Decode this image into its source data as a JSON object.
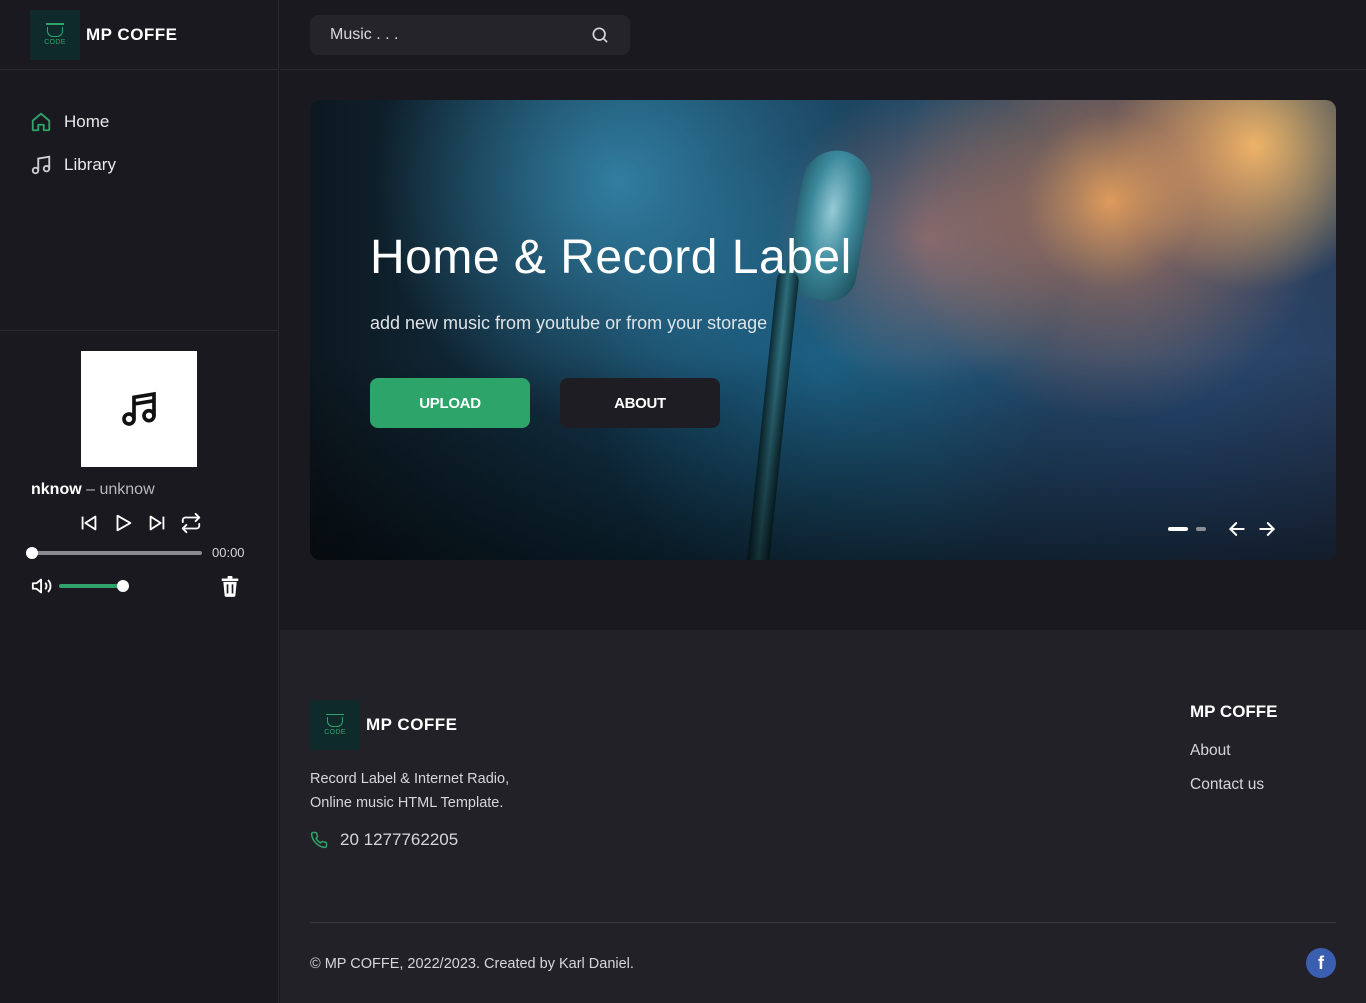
{
  "brand": {
    "name": "MP COFFE",
    "logo_text": "CODE"
  },
  "sidebar": {
    "items": [
      {
        "label": "Home",
        "icon": "home-icon",
        "active": true
      },
      {
        "label": "Library",
        "icon": "music-note-icon",
        "active": false
      }
    ]
  },
  "player": {
    "track_title": "nknow",
    "separator": "–",
    "artist": "unknow",
    "time": "00:00",
    "progress": 0,
    "volume": 1
  },
  "search": {
    "placeholder": "Music . . ."
  },
  "hero": {
    "title": "Home & Record Label",
    "subtitle": "add new music from youtube or from your storage",
    "upload_label": "UPLOAD",
    "about_label": "ABOUT",
    "active_slide": 1,
    "slide_count": 2
  },
  "footer": {
    "brand_name": "MP COFFE",
    "desc_line1": "Record Label & Internet Radio,",
    "desc_line2": "Online music HTML Template.",
    "phone": "20 1277762205",
    "col_title": "MP COFFE",
    "links": [
      "About",
      "Contact us"
    ],
    "copyright": "© MP COFFE, 2022/2023. Created by Karl Daniel.",
    "social": "f"
  },
  "colors": {
    "accent": "#2da56a",
    "bg": "#1a191f",
    "footer_bg": "#222128",
    "facebook": "#3b5fb0"
  }
}
